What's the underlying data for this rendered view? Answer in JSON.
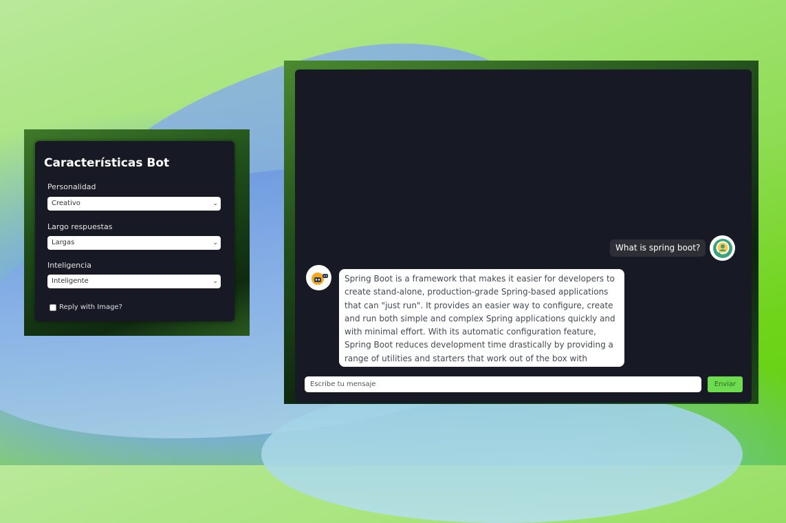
{
  "settings": {
    "title": "Características Bot",
    "personality": {
      "label": "Personalidad",
      "value": "Creativo"
    },
    "length": {
      "label": "Largo respuestas",
      "value": "Largas"
    },
    "intelligence": {
      "label": "Inteligencia",
      "value": "Inteligente"
    },
    "image_reply": {
      "label": "Reply with Image?",
      "checked": false
    }
  },
  "chat": {
    "messages": [
      {
        "role": "user",
        "text": "What is spring boot?"
      },
      {
        "role": "bot",
        "text": "Spring Boot is a framework that makes it easier for developers to create stand-alone, production-grade Spring-based applications that can \"just run\". It provides an easier way to configure, create and run both simple and complex Spring applications quickly and with minimal effort. With its automatic configuration feature, Spring Boot reduces development time drastically by providing a range of utilities and starters that work out of the box with minimal setup."
      }
    ],
    "input": {
      "placeholder": "Escribe tu mensaje"
    },
    "send_label": "Enviar"
  },
  "colors": {
    "panel_bg": "#171a24",
    "send_button": "#6ddc4e",
    "bot_avatar_accent": "#f5a623",
    "user_avatar_accent": "#3aa37a"
  },
  "icons": {
    "select_chevron": "chevron-down-icon",
    "user_avatar": "user-avatar-icon",
    "bot_avatar": "robot-icon"
  }
}
